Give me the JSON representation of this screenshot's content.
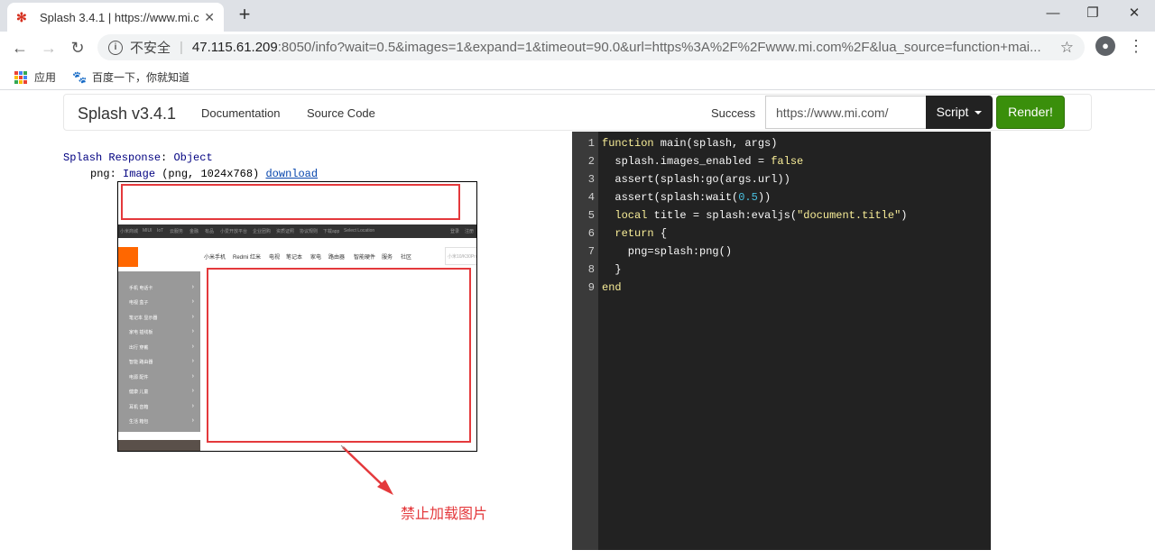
{
  "browser": {
    "tab_title": "Splash 3.4.1 | https://www.mi.co",
    "tab_close": "✕",
    "new_tab": "+",
    "window_min": "—",
    "window_restore": "❐",
    "window_close": "✕",
    "address": {
      "insecure_label": "不安全",
      "host": "47.115.61.209",
      "path": ":8050/info?wait=0.5&images=1&expand=1&timeout=90.0&url=https%3A%2F%2Fwww.mi.com%2F&lua_source=function+mai..."
    },
    "bookmarks": [
      {
        "label": "应用"
      },
      {
        "label": "百度一下，你就知道"
      }
    ]
  },
  "navbar": {
    "brand": "Splash v3.4.1",
    "links": [
      "Documentation",
      "Source Code"
    ],
    "status": "Success",
    "url_value": "https://www.mi.com/",
    "script_label": "Script",
    "render_label": "Render!"
  },
  "response": {
    "title_prefix": "Splash Response",
    "title_type": "Object",
    "png_key": "png",
    "png_type": "Image",
    "png_info": "(png, 1024x768)",
    "download": "download"
  },
  "screenshot": {
    "topbar_items": [
      "小米商城",
      "MIUI",
      "IoT",
      "云服务",
      "金融",
      "有品",
      "小爱开放平台",
      "企业团购",
      "资质证照",
      "协议规则",
      "下载app",
      "Select Location"
    ],
    "topbar_right": [
      "登录",
      "注册"
    ],
    "nav_items": [
      "小米手机",
      "Redmi 红米",
      "电视",
      "笔记本",
      "家电",
      "路由器",
      "智能硬件",
      "服务",
      "社区"
    ],
    "search_placeholder": "小米10/K30Pro",
    "side_items": [
      "手机 电话卡",
      "电视 盒子",
      "笔记本 显示器",
      "家电 插线板",
      "出行 穿戴",
      "智能 路由器",
      "电源 配件",
      "健康 儿童",
      "耳机 音箱",
      "生活 箱包"
    ]
  },
  "annotation": {
    "text": "禁止加载图片",
    "color": "#e4393c"
  },
  "editor": {
    "line_numbers": [
      "1",
      "2",
      "3",
      "4",
      "5",
      "6",
      "7",
      "8",
      "9"
    ],
    "lines": [
      [
        {
          "t": "function",
          "c": "k"
        },
        {
          "t": " main(splash, args)",
          "c": "fn"
        }
      ],
      [
        {
          "t": "  splash.images_enabled = ",
          "c": "fn"
        },
        {
          "t": "false",
          "c": "k"
        }
      ],
      [
        {
          "t": "  assert(splash:go(args.url))",
          "c": "fn"
        }
      ],
      [
        {
          "t": "  assert(splash:wait(",
          "c": "fn"
        },
        {
          "t": "0.5",
          "c": "cyan"
        },
        {
          "t": "))",
          "c": "fn"
        }
      ],
      [
        {
          "t": "  ",
          "c": "fn"
        },
        {
          "t": "local",
          "c": "k"
        },
        {
          "t": " title = splash:evaljs(",
          "c": "fn"
        },
        {
          "t": "\"document.title\"",
          "c": "k"
        },
        {
          "t": ")",
          "c": "fn"
        }
      ],
      [
        {
          "t": "  ",
          "c": "fn"
        },
        {
          "t": "return",
          "c": "k"
        },
        {
          "t": " {",
          "c": "fn"
        }
      ],
      [
        {
          "t": "    png=splash:png()",
          "c": "fn"
        }
      ],
      [
        {
          "t": "  }",
          "c": "fn"
        }
      ],
      [
        {
          "t": "end",
          "c": "k"
        }
      ]
    ]
  },
  "colors": {
    "render_green": "#3a8f0b",
    "highlight_red": "#e4393c",
    "mi_orange": "#ff6700",
    "editor_bg": "#222222"
  }
}
